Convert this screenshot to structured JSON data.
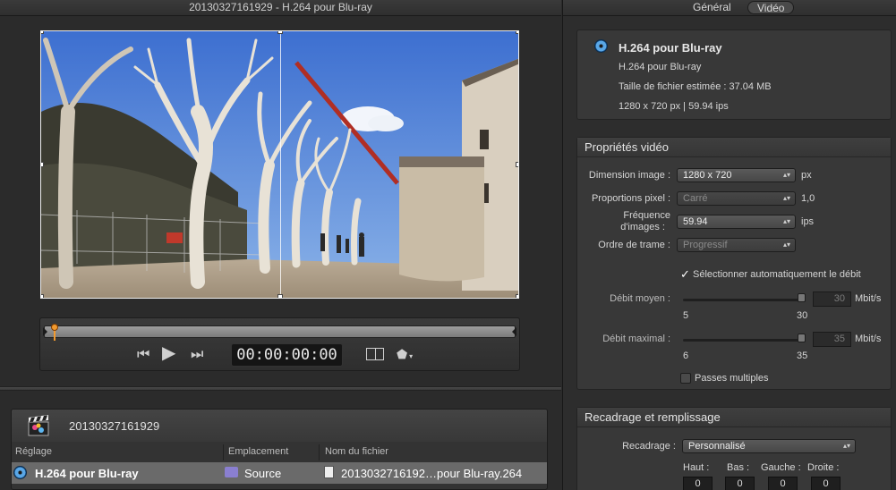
{
  "left": {
    "title": "20130327161929 - H.264 pour Blu-ray",
    "timecode": "00:00:00:00"
  },
  "batch": {
    "name": "20130327161929",
    "columns": {
      "setting": "Réglage",
      "location": "Emplacement",
      "filename": "Nom du fichier"
    },
    "row": {
      "setting": "H.264 pour Blu-ray",
      "location": "Source",
      "filename": "2013032716192…pour Blu-ray.264"
    }
  },
  "tabs": {
    "general": "Général",
    "video": "Vidéo"
  },
  "summary": {
    "title": "H.264 pour Blu-ray",
    "subtitle": "H.264 pour Blu-ray",
    "filesize": "Taille de fichier estimée : 37.04 MB",
    "resolution": "1280 x 720 px | 59.94 ips"
  },
  "video_props": {
    "header": "Propriétés vidéo",
    "dimension_label": "Dimension image :",
    "dimension_value": "1280 x 720",
    "dimension_unit": "px",
    "pixel_label": "Proportions pixel :",
    "pixel_value": "Carré",
    "pixel_unit": "1,0",
    "fps_label_1": "Fréquence",
    "fps_label_2": "d'images :",
    "fps_value": "59.94",
    "fps_unit": "ips",
    "field_label": "Ordre de trame :",
    "field_value": "Progressif",
    "auto_bitrate": "Sélectionner automatiquement le débit",
    "avg_label": "Débit moyen :",
    "avg_value": "30",
    "avg_unit": "Mbit/s",
    "avg_min": "5",
    "avg_max": "30",
    "max_label": "Débit maximal :",
    "max_value": "35",
    "max_unit": "Mbit/s",
    "max_min": "6",
    "max_max": "35",
    "multipass": "Passes multiples"
  },
  "crop": {
    "header": "Recadrage et remplissage",
    "crop_label": "Recadrage :",
    "crop_value": "Personnalisé",
    "top_label": "Haut :",
    "bottom_label": "Bas :",
    "left_label": "Gauche :",
    "right_label": "Droite :",
    "top": "0",
    "bottom": "0",
    "left": "0",
    "right": "0"
  }
}
